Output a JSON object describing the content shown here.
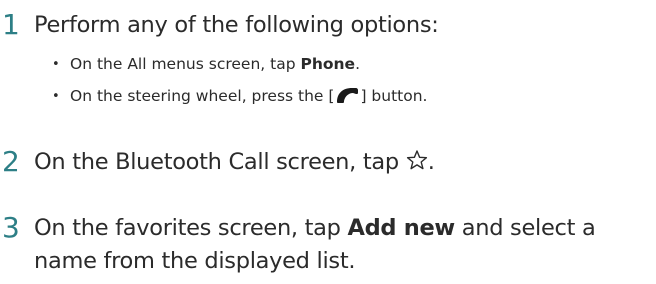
{
  "steps": [
    {
      "number": "1",
      "text": "Perform any of the following options:",
      "options": [
        {
          "pre": "On the All menus screen, tap ",
          "bold": "Phone",
          "post": "."
        },
        {
          "pre": "On the steering wheel, press the [",
          "icon": "phone-handset-icon",
          "post": "] button."
        }
      ]
    },
    {
      "number": "2",
      "pre": "On the Bluetooth Call screen, tap ",
      "icon": "star-outline-icon",
      "post": "."
    },
    {
      "number": "3",
      "pre": "On the favorites screen, tap ",
      "bold": "Add new",
      "post": " and select a name from the displayed list."
    }
  ],
  "colors": {
    "step_number": "#2d7f86",
    "text": "#2b2b2b",
    "background": "#ffffff"
  }
}
